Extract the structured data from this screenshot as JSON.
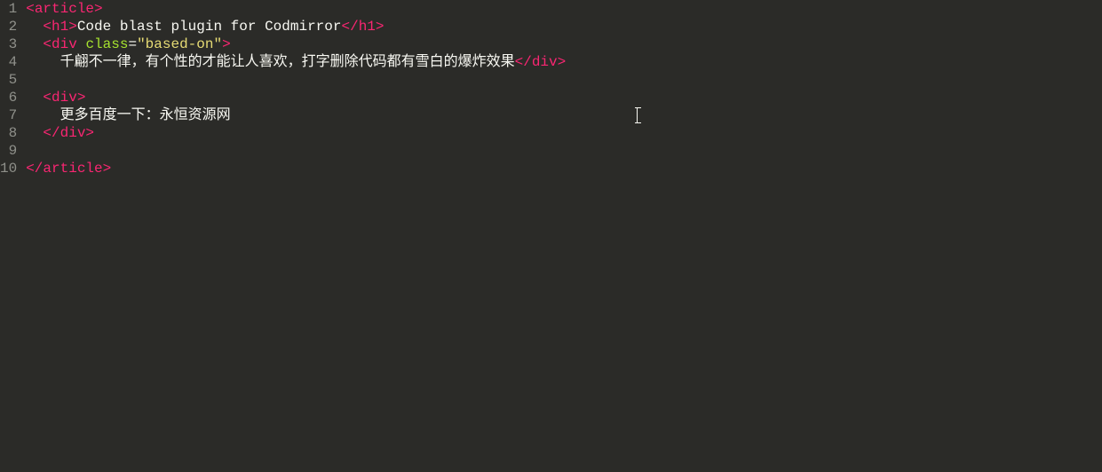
{
  "lineNumbers": [
    "1",
    "2",
    "3",
    "4",
    "5",
    "6",
    "7",
    "8",
    "9",
    "10"
  ],
  "lines": {
    "l1": {
      "openBracket": "<",
      "tag": "article",
      "closeBracket": ">"
    },
    "l2": {
      "indent": "  ",
      "openBracket": "<",
      "tag": "h1",
      "closeBracket": ">",
      "text": "Code blast plugin for Codmirror",
      "endOpenBracket": "</",
      "endTag": "h1",
      "endCloseBracket": ">"
    },
    "l3": {
      "indent": "  ",
      "openBracket": "<",
      "tag": "div",
      "space": " ",
      "attrName": "class",
      "eq": "=",
      "attrValue": "\"based-on\"",
      "closeBracket": ">"
    },
    "l4": {
      "indent": "    ",
      "text": "千翩不一律，有个性的才能让人喜欢，打字删除代码都有雪白的爆炸效果",
      "endOpenBracket": "</",
      "endTag": "div",
      "endCloseBracket": ">"
    },
    "l5": {
      "indent": ""
    },
    "l6": {
      "indent": "  ",
      "openBracket": "<",
      "tag": "div",
      "closeBracket": ">"
    },
    "l7": {
      "indent": "    ",
      "text": "更多百度一下：永恒资源网"
    },
    "l8": {
      "indent": "  ",
      "endOpenBracket": "</",
      "endTag": "div",
      "endCloseBracket": ">"
    },
    "l9": {
      "indent": ""
    },
    "l10": {
      "endOpenBracket": "</",
      "endTag": "article",
      "endCloseBracket": ">"
    }
  }
}
